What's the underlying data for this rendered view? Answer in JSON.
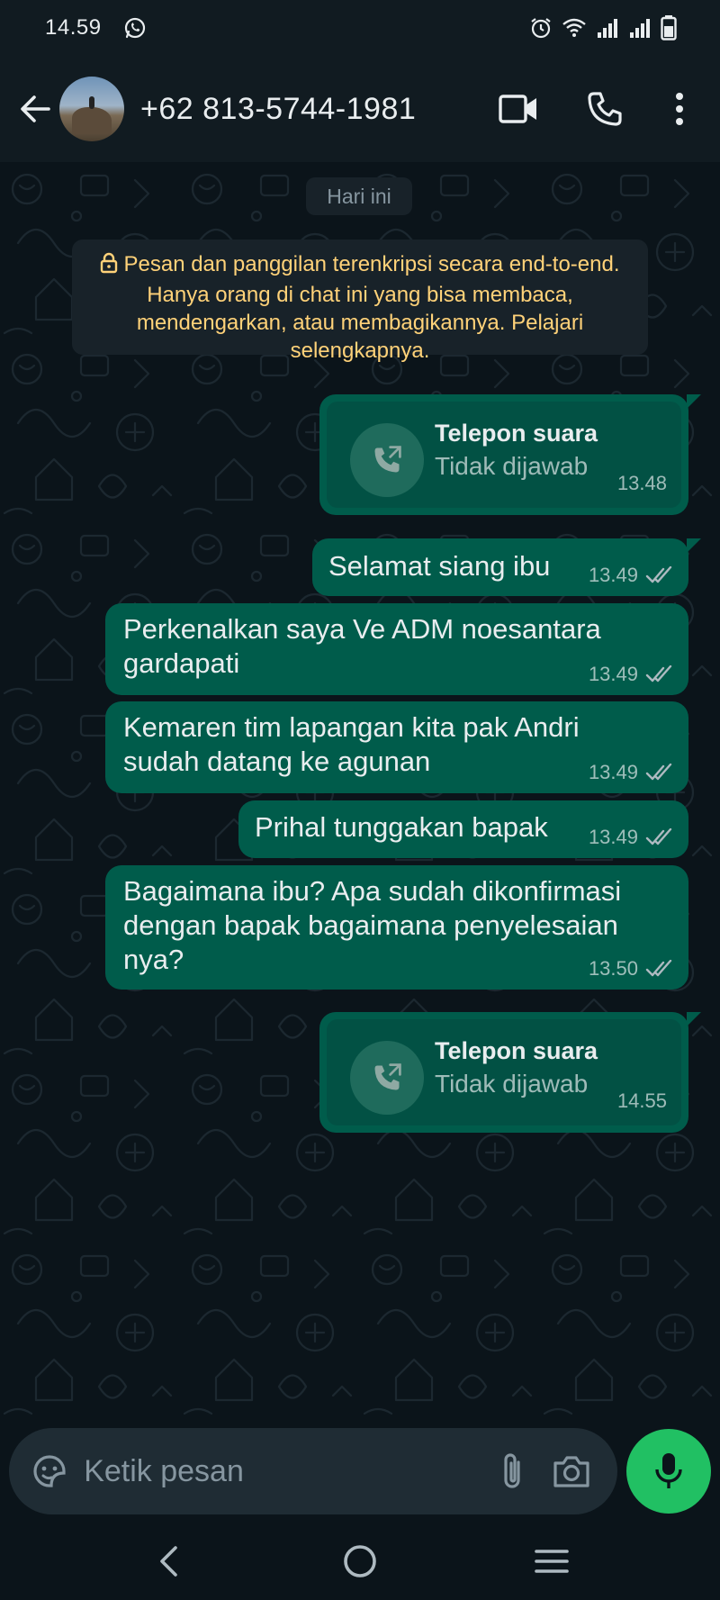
{
  "status_bar": {
    "time": "14.59",
    "icons": [
      "whatsapp-icon",
      "alarm-icon",
      "wifi-icon",
      "signal-icon",
      "signal-icon",
      "battery-icon"
    ]
  },
  "header": {
    "contact_name": "+62 813-5744-1981",
    "actions": [
      "video-call-icon",
      "voice-call-icon",
      "more-vert-icon"
    ]
  },
  "chat": {
    "date_chip": "Hari ini",
    "encryption_notice": "Pesan dan panggilan terenkripsi secara end-to-end. Hanya orang di chat ini yang bisa membaca, mendengarkan, atau membagikannya. Pelajari selengkapnya.",
    "messages": [
      {
        "type": "call",
        "title": "Telepon suara",
        "status": "Tidak dijawab",
        "time": "13.48"
      },
      {
        "type": "text",
        "text": "Selamat siang ibu",
        "time": "13.49",
        "ticks": "double"
      },
      {
        "type": "text",
        "text": "Perkenalkan saya Ve ADM noesantara\ngardapati",
        "time": "13.49",
        "ticks": "double"
      },
      {
        "type": "text",
        "text": "Kemaren tim lapangan kita pak Andri\nsudah datang ke agunan",
        "time": "13.49",
        "ticks": "double"
      },
      {
        "type": "text",
        "text": "Prihal tunggakan bapak",
        "time": "13.49",
        "ticks": "double"
      },
      {
        "type": "text",
        "text": "Bagaimana ibu? Apa sudah dikonfirmasi\ndengan bapak bagaimana penyelesaian\nnya?",
        "time": "13.50",
        "ticks": "double"
      },
      {
        "type": "call",
        "title": "Telepon suara",
        "status": "Tidak dijawab",
        "time": "14.55"
      }
    ]
  },
  "composer": {
    "placeholder": "Ketik pesan",
    "value": ""
  },
  "colors": {
    "bubble_out": "#005c4b",
    "accent_green": "#21c063",
    "notice_text": "#ffd279",
    "header_bg": "#111b21",
    "chat_bg": "#0b141a"
  }
}
